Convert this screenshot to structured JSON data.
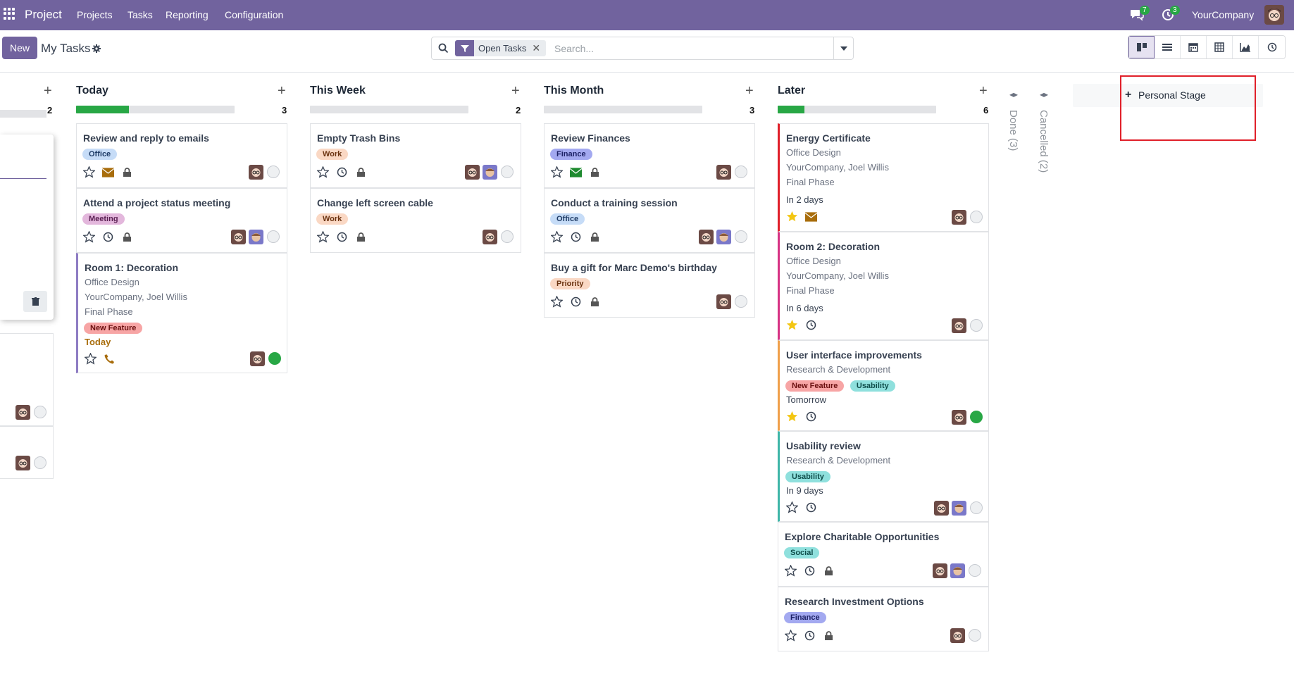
{
  "topbar": {
    "app_name": "Project",
    "menu": [
      "Projects",
      "Tasks",
      "Reporting",
      "Configuration"
    ],
    "messages_count": "7",
    "activities_count": "3",
    "company": "YourCompany"
  },
  "control": {
    "new_label": "New",
    "title": "My Tasks",
    "filter_facet": "Open Tasks",
    "search_placeholder": "Search..."
  },
  "views": [
    "kanban-icon",
    "list-icon",
    "calendar-icon",
    "pivot-icon",
    "graph-icon",
    "activity-icon"
  ],
  "left_column": {
    "count": "2"
  },
  "columns": [
    {
      "title": "Today",
      "count": "3",
      "progress": 0.35
    },
    {
      "title": "This Week",
      "count": "2",
      "progress": 0
    },
    {
      "title": "This Month",
      "count": "3",
      "progress": 0
    },
    {
      "title": "Later",
      "count": "6",
      "progress": 0.17
    }
  ],
  "cards": {
    "today": [
      {
        "title": "Review and reply to emails",
        "tags": [
          {
            "label": "Office",
            "color": "#c6dcf7"
          }
        ]
      },
      {
        "title": "Attend a project status meeting",
        "tags": [
          {
            "label": "Meeting",
            "color": "#e3b7dc"
          }
        ]
      },
      {
        "title": "Room 1: Decoration",
        "project": "Office Design",
        "partner": "YourCompany, Joel Willis",
        "milestone": "Final Phase",
        "tags": [
          {
            "label": "New Feature",
            "color": "#f7a5a5"
          }
        ],
        "deadline": "Today"
      }
    ],
    "week": [
      {
        "title": "Empty Trash Bins",
        "tags": [
          {
            "label": "Work",
            "color": "#fad8c4"
          }
        ]
      },
      {
        "title": "Change left screen cable",
        "tags": [
          {
            "label": "Work",
            "color": "#fad8c4"
          }
        ]
      }
    ],
    "month": [
      {
        "title": "Review Finances",
        "tags": [
          {
            "label": "Finance",
            "color": "#a3a9f0"
          }
        ]
      },
      {
        "title": "Conduct a training session",
        "tags": [
          {
            "label": "Office",
            "color": "#c6dcf7"
          }
        ]
      },
      {
        "title": "Buy a gift for Marc Demo's birthday",
        "tags": [
          {
            "label": "Priority",
            "color": "#fad8c4"
          }
        ]
      }
    ],
    "later": [
      {
        "title": "Energy Certificate",
        "project": "Office Design",
        "partner": "YourCompany, Joel Willis",
        "milestone": "Final Phase",
        "deadline": "In 2 days"
      },
      {
        "title": "Room 2: Decoration",
        "project": "Office Design",
        "partner": "YourCompany, Joel Willis",
        "milestone": "Final Phase",
        "deadline": "In 6 days"
      },
      {
        "title": "User interface improvements",
        "project": "Research & Development",
        "tags": [
          {
            "label": "New Feature",
            "color": "#f7a5a5"
          },
          {
            "label": "Usability",
            "color": "#8fe0dd"
          }
        ],
        "deadline": "Tomorrow"
      },
      {
        "title": "Usability review",
        "project": "Research & Development",
        "tags": [
          {
            "label": "Usability",
            "color": "#8fe0dd"
          }
        ],
        "deadline": "In 9 days"
      },
      {
        "title": "Explore Charitable Opportunities",
        "tags": [
          {
            "label": "Social",
            "color": "#8fe0dd"
          }
        ]
      },
      {
        "title": "Research Investment Options",
        "tags": [
          {
            "label": "Finance",
            "color": "#a3a9f0"
          }
        ]
      }
    ]
  },
  "folded": [
    {
      "label": "Done (3)"
    },
    {
      "label": "Cancelled (2)"
    }
  ],
  "personal_stage": "Personal Stage",
  "colors": {
    "accent": "#71639e",
    "success": "#28a745",
    "star": "#f3c612",
    "mail": "#a86d0c"
  }
}
